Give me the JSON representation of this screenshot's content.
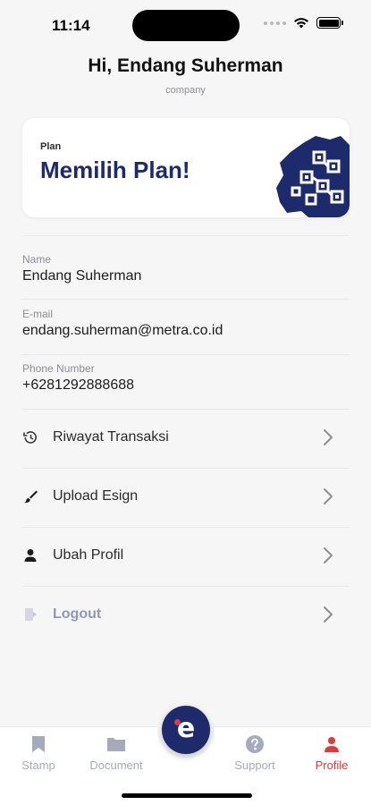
{
  "status_bar": {
    "time": "11:14"
  },
  "header": {
    "greeting": "Hi,  Endang Suherman",
    "subtitle": "company"
  },
  "plan_card": {
    "label": "Plan",
    "title": "Memilih Plan!"
  },
  "profile_fields": [
    {
      "label": "Name",
      "value": "Endang Suherman"
    },
    {
      "label": "E-mail",
      "value": "endang.suherman@metra.co.id"
    },
    {
      "label": "Phone Number",
      "value": "+6281292888688"
    }
  ],
  "menu": [
    {
      "label": "Riwayat Transaksi",
      "icon": "history-icon"
    },
    {
      "label": "Upload Esign",
      "icon": "brush-icon"
    },
    {
      "label": "Ubah Profil",
      "icon": "person-icon"
    },
    {
      "label": "Logout",
      "icon": "logout-icon"
    }
  ],
  "tabbar": {
    "tabs": [
      {
        "label": "Stamp",
        "icon": "bookmark-icon"
      },
      {
        "label": "Document",
        "icon": "folder-icon"
      },
      {
        "label": "Support",
        "icon": "help-icon"
      },
      {
        "label": "Profile",
        "icon": "person-icon",
        "active": true
      }
    ],
    "center_button": {
      "letter": "e"
    }
  },
  "colors": {
    "brand_navy": "#1d2a6b",
    "accent_red": "#e23a3a",
    "inactive": "#a6aabb"
  }
}
